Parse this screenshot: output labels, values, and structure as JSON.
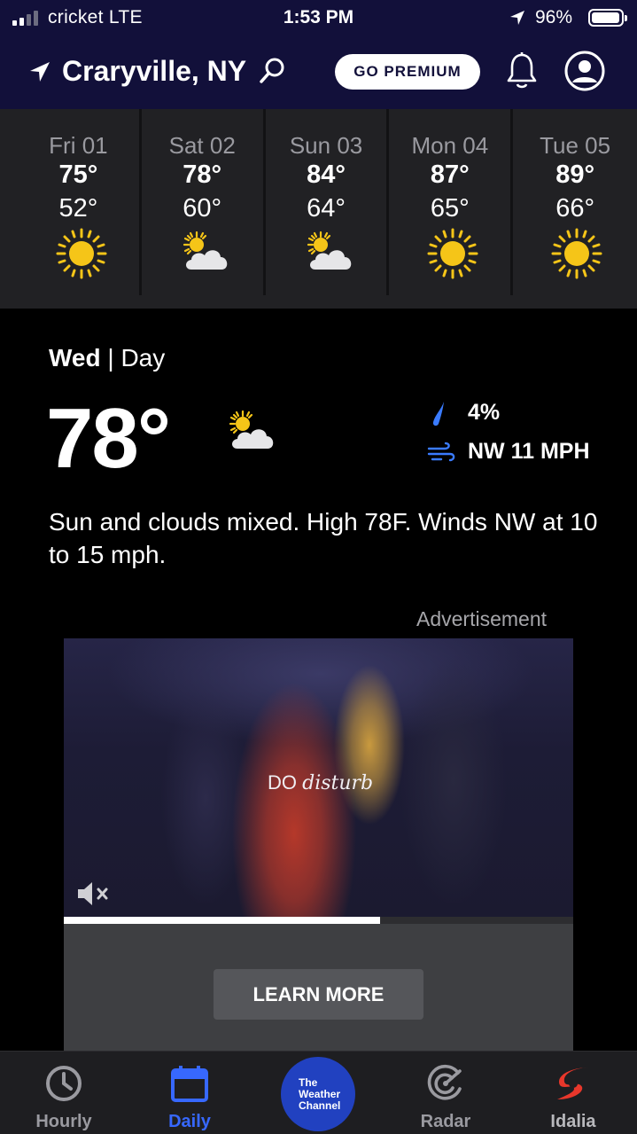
{
  "status_bar": {
    "carrier": "cricket  LTE",
    "time": "1:53 PM",
    "battery": "96%",
    "battery_level": 0.96
  },
  "header": {
    "location": "Craryville, NY",
    "premium_label": "GO PREMIUM"
  },
  "daily": [
    {
      "day": "Fri 01",
      "high": "75°",
      "low": "52°",
      "icon": "sun-icon"
    },
    {
      "day": "Sat 02",
      "high": "78°",
      "low": "60°",
      "icon": "partly-cloudy-icon"
    },
    {
      "day": "Sun 03",
      "high": "84°",
      "low": "64°",
      "icon": "partly-cloudy-icon"
    },
    {
      "day": "Mon 04",
      "high": "87°",
      "low": "65°",
      "icon": "sun-icon"
    },
    {
      "day": "Tue 05",
      "high": "89°",
      "low": "66°",
      "icon": "sun-icon"
    }
  ],
  "detail": {
    "day": "Wed",
    "period": "| Day",
    "temp": "78°",
    "icon": "partly-cloudy-icon",
    "precip": "4%",
    "wind": "NW 11 MPH",
    "narrative": "Sun and clouds mixed. High 78F. Winds NW at 10 to 15 mph."
  },
  "ad": {
    "label": "Advertisement",
    "caption_bold": "DO",
    "caption_italic": "disturb",
    "progress": 0.62,
    "cta": "LEARN MORE"
  },
  "nav": {
    "hourly": "Hourly",
    "daily": "Daily",
    "logo_line1": "The",
    "logo_line2": "Weather",
    "logo_line3": "Channel",
    "radar": "Radar",
    "alert": "Idalia"
  },
  "colors": {
    "header_bg": "#12103a",
    "accent": "#3768ff",
    "sun": "#f5c518",
    "precip": "#3a7bff",
    "alert": "#e8372b"
  }
}
